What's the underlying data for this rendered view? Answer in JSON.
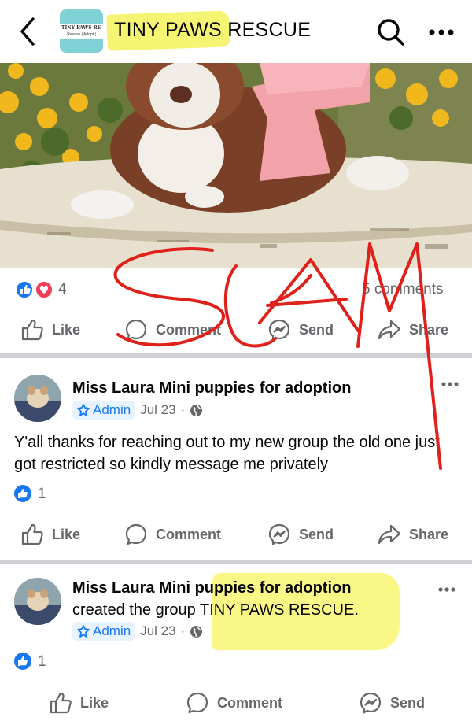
{
  "header": {
    "group_name_highlighted": "TINY PAWS",
    "group_name_rest": " RESCUE",
    "logo_line1": "TINY PAWS RESCUE",
    "logo_line2": "Rescue | Adopt |",
    "icons": [
      "back-chevron-icon",
      "search-icon",
      "more-icon"
    ]
  },
  "post": {
    "reaction_count": "4",
    "comments_text": "5 comments",
    "actions": [
      "Like",
      "Comment",
      "Send",
      "Share"
    ],
    "annotation": "SCAM"
  },
  "comments": [
    {
      "author": "Miss Laura Mini puppies for adoption",
      "badge": "Admin",
      "date": "Jul 23",
      "separator": "·",
      "text": "Y'all thanks for reaching out to my new group the old one just got restricted so kindly message me privately",
      "likes": "1",
      "actions": [
        "Like",
        "Comment",
        "Send",
        "Share"
      ]
    },
    {
      "author": "Miss Laura Mini puppies for adoption",
      "action_text": "created the group",
      "group_name": "TINY PAWS RESCUE",
      "period": ".",
      "badge": "Admin",
      "date": "Jul 23",
      "separator": "·",
      "likes": "1",
      "actions": [
        "Like",
        "Comment",
        "Send"
      ]
    }
  ],
  "colors": {
    "facebook_blue": "#1877f2",
    "highlight_yellow": "#f4f25a",
    "scribble_red": "#e0201a",
    "secondary_text": "#65676b",
    "divider": "#ced0d4"
  }
}
